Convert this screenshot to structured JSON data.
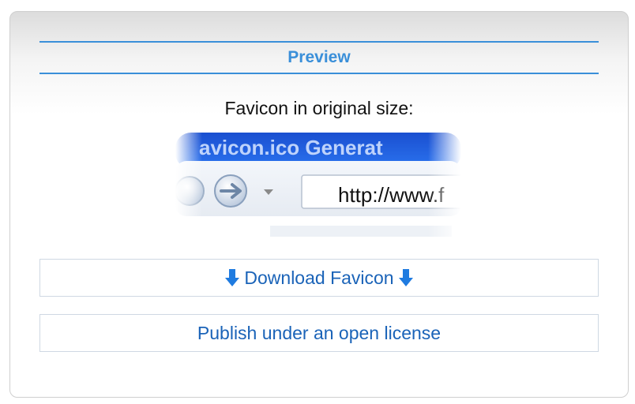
{
  "panel": {
    "heading": "Preview",
    "caption": "Favicon in original size:"
  },
  "preview_image": {
    "title_text": "avicon.ico Generat",
    "address_text": "http://www.f"
  },
  "buttons": {
    "download_label": "Download Favicon",
    "publish_label": "Publish under an open license"
  },
  "colors": {
    "accent": "#3a8fd9",
    "link": "#1a63b8",
    "arrow": "#1f7be0"
  },
  "icons": {
    "download_left": "arrow-down-icon",
    "download_right": "arrow-down-icon"
  }
}
